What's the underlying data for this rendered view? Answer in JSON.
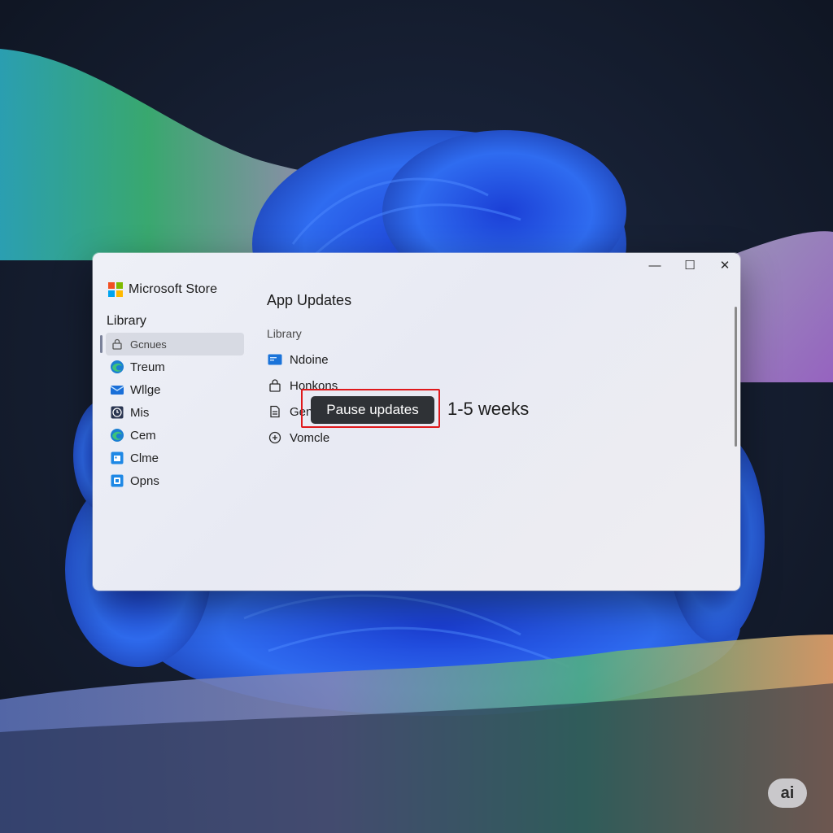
{
  "window": {
    "app_name": "Microsoft Store",
    "controls": {
      "minimize": "—",
      "maximize": "☐",
      "close": "✕"
    }
  },
  "sidebar": {
    "heading": "Library",
    "items": [
      {
        "label": "Gcnues",
        "icon": "lock-icon",
        "selected": true
      },
      {
        "label": "Treum",
        "icon": "edge-icon"
      },
      {
        "label": "Wllge",
        "icon": "mail-icon"
      },
      {
        "label": "Mis",
        "icon": "clock-icon"
      },
      {
        "label": "Cem",
        "icon": "edge-icon"
      },
      {
        "label": "Clme",
        "icon": "calendar-icon"
      },
      {
        "label": "Opns",
        "icon": "store-icon"
      }
    ]
  },
  "main": {
    "title": "App Updates",
    "section_label": "Library",
    "rows": [
      {
        "label": "Ndoine",
        "icon": "app-tile-icon"
      },
      {
        "label": "Honkons",
        "icon": "bag-icon"
      },
      {
        "label": "Gen",
        "icon": "document-icon"
      },
      {
        "label": "Vomcle",
        "icon": "plus-circle-icon"
      }
    ],
    "pause_button": "Pause updates",
    "pause_duration": "1-5 weeks"
  },
  "badge": {
    "text": "ai"
  },
  "colors": {
    "accent_blue": "#2a62e0",
    "highlight_red": "#e0191c",
    "button_dark": "#2f3236"
  }
}
